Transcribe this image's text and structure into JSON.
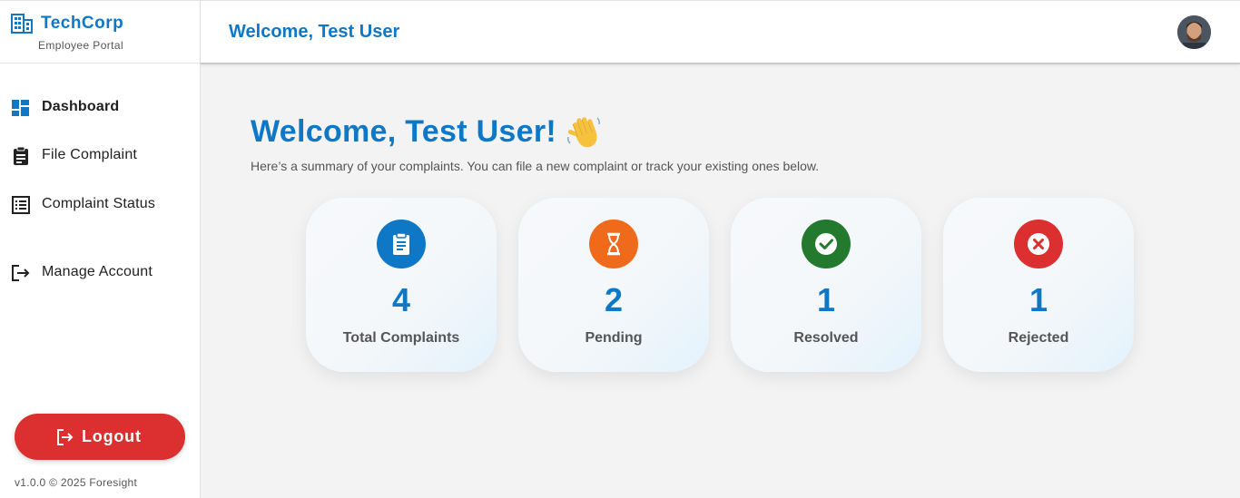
{
  "brand": {
    "name": "TechCorp",
    "subtitle": "Employee Portal",
    "icon": "building-icon"
  },
  "sidebar": {
    "items": [
      {
        "label": "Dashboard",
        "icon": "dashboard-icon",
        "active": true
      },
      {
        "label": "File Complaint",
        "icon": "clipboard-icon",
        "active": false
      },
      {
        "label": "Complaint Status",
        "icon": "list-icon",
        "active": false
      },
      {
        "label": "Manage Account",
        "icon": "exit-icon",
        "active": false
      }
    ],
    "logout_label": "Logout",
    "version": "v1.0.0 © 2025 Foresight"
  },
  "header": {
    "title": "Welcome, Test User"
  },
  "main": {
    "title": "Welcome, Test User!",
    "subtitle": "Here’s a summary of your complaints. You can file a new complaint or track your existing ones below.",
    "stats": [
      {
        "value": "4",
        "label": "Total Complaints",
        "icon": "clipboard-icon",
        "color": "#0f78c6"
      },
      {
        "value": "2",
        "label": "Pending",
        "icon": "hourglass-icon",
        "color": "#f06a1c"
      },
      {
        "value": "1",
        "label": "Resolved",
        "icon": "check-circle-icon",
        "color": "#237a2f"
      },
      {
        "value": "1",
        "label": "Rejected",
        "icon": "x-circle-icon",
        "color": "#dc2f2f"
      }
    ]
  },
  "colors": {
    "accent": "#0f78c6",
    "danger": "#dc2f2f",
    "warning": "#f06a1c",
    "success": "#237a2f"
  }
}
